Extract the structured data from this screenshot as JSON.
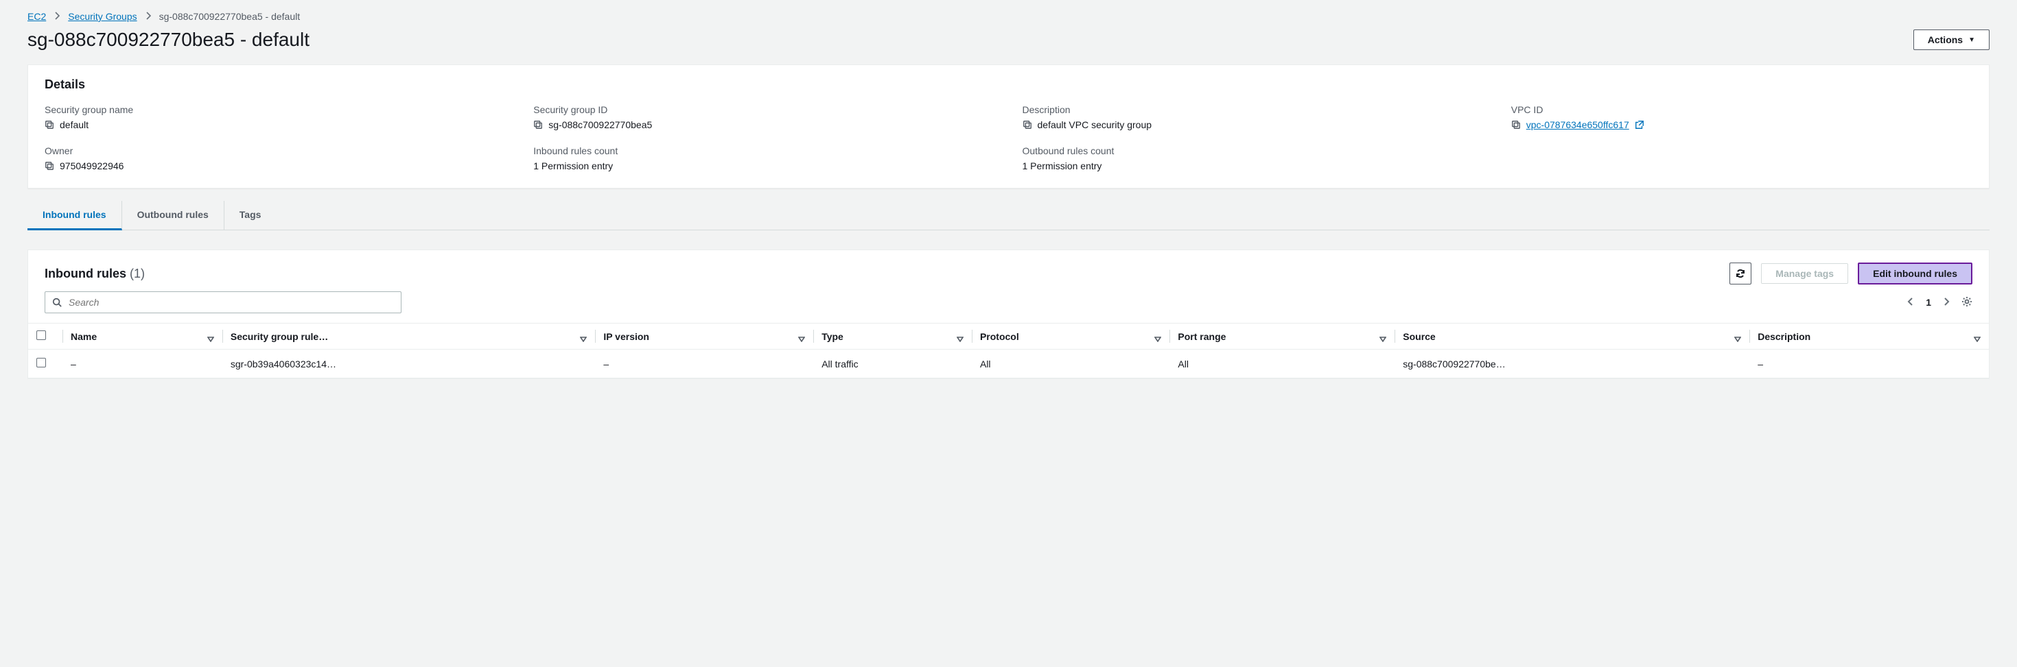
{
  "breadcrumb": {
    "root": "EC2",
    "parent": "Security Groups",
    "current": "sg-088c700922770bea5 - default"
  },
  "page_title": "sg-088c700922770bea5 - default",
  "actions_button": "Actions",
  "details": {
    "heading": "Details",
    "items": {
      "sg_name": {
        "label": "Security group name",
        "value": "default"
      },
      "sg_id": {
        "label": "Security group ID",
        "value": "sg-088c700922770bea5"
      },
      "desc": {
        "label": "Description",
        "value": "default VPC security group"
      },
      "vpc": {
        "label": "VPC ID",
        "value": "vpc-0787634e650ffc617"
      },
      "owner": {
        "label": "Owner",
        "value": "975049922946"
      },
      "inbound": {
        "label": "Inbound rules count",
        "value": "1 Permission entry"
      },
      "outbound": {
        "label": "Outbound rules count",
        "value": "1 Permission entry"
      }
    }
  },
  "tabs": {
    "inbound": "Inbound rules",
    "outbound": "Outbound rules",
    "tags": "Tags"
  },
  "inbound_panel": {
    "title": "Inbound rules",
    "count": "(1)",
    "manage_tags": "Manage tags",
    "edit": "Edit inbound rules",
    "search_placeholder": "Search",
    "page": "1"
  },
  "table": {
    "headers": {
      "name": "Name",
      "sgr": "Security group rule…",
      "ipv": "IP version",
      "type": "Type",
      "protocol": "Protocol",
      "port": "Port range",
      "source": "Source",
      "desc": "Description"
    },
    "rows": [
      {
        "name": "–",
        "sgr": "sgr-0b39a4060323c14…",
        "ipv": "–",
        "type": "All traffic",
        "protocol": "All",
        "port": "All",
        "source": "sg-088c700922770be…",
        "desc": "–"
      }
    ]
  }
}
